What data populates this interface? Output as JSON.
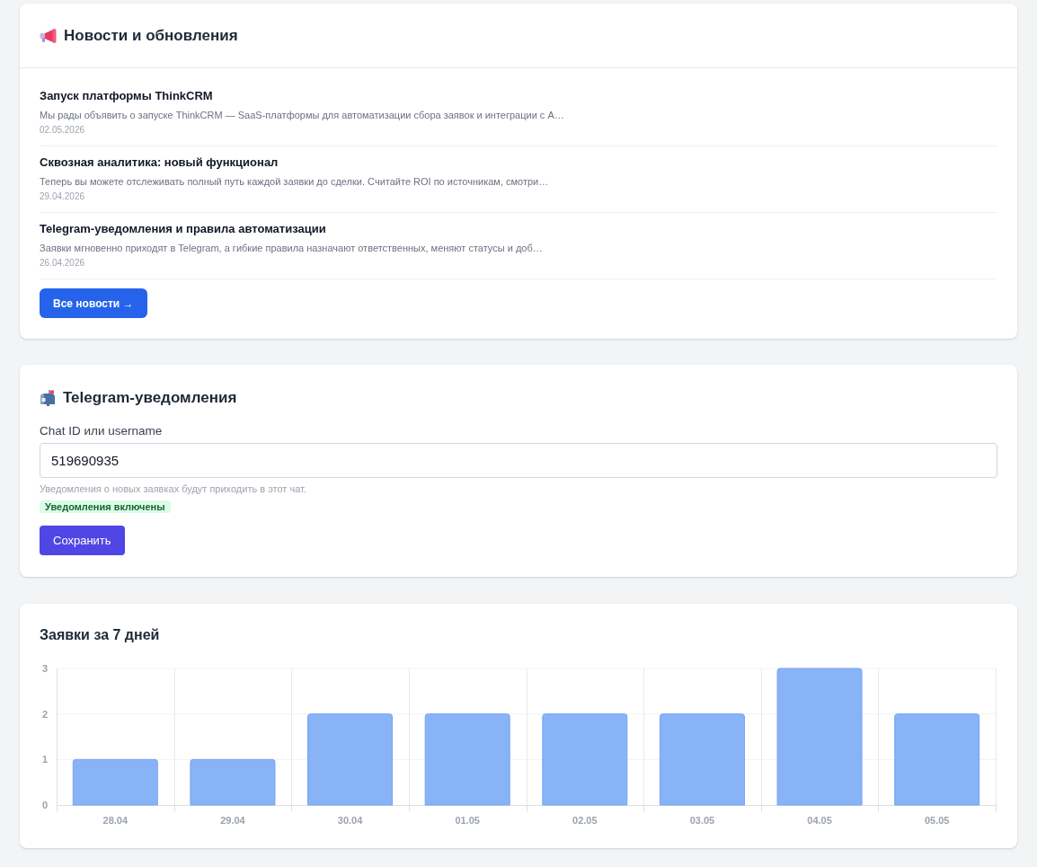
{
  "news": {
    "title": "Новости и обновления",
    "items": [
      {
        "title": "Запуск платформы ThinkCRM",
        "text": "Мы рады объявить о запуске ThinkCRM — SaaS-платформы для автоматизации сбора заявок и интеграции с А…",
        "date": "02.05.2026"
      },
      {
        "title": "Сквозная аналитика: новый функционал",
        "text": "Теперь вы можете отслеживать полный путь каждой заявки до сделки. Считайте ROI по источникам, смотри…",
        "date": "29.04.2026"
      },
      {
        "title": "Telegram-уведомления и правила автоматизации",
        "text": "Заявки мгновенно приходят в Telegram, а гибкие правила назначают ответственных, меняют статусы и доб…",
        "date": "26.04.2026"
      }
    ],
    "button": "Все новости →"
  },
  "telegram": {
    "title": "Telegram-уведомления",
    "field": {
      "label": "Chat ID или username",
      "value": "519690935",
      "hint": "Уведомления о новых заявках будут приходить в этот чат."
    },
    "status": {
      "text": "Уведомления включены",
      "enabled": true
    },
    "button": "Сохранить"
  },
  "chart_card": {
    "title": "Заявки за 7 дней",
    "chart_data": {
      "type": "bar",
      "categories": [
        "28.04",
        "29.04",
        "30.04",
        "01.05",
        "02.05",
        "03.05",
        "04.05",
        "05.05"
      ],
      "values": [
        1,
        1,
        2,
        2,
        2,
        2,
        3,
        2
      ],
      "ylim": [
        0,
        3
      ],
      "yticks": [
        0,
        1,
        2,
        3
      ]
    }
  }
}
